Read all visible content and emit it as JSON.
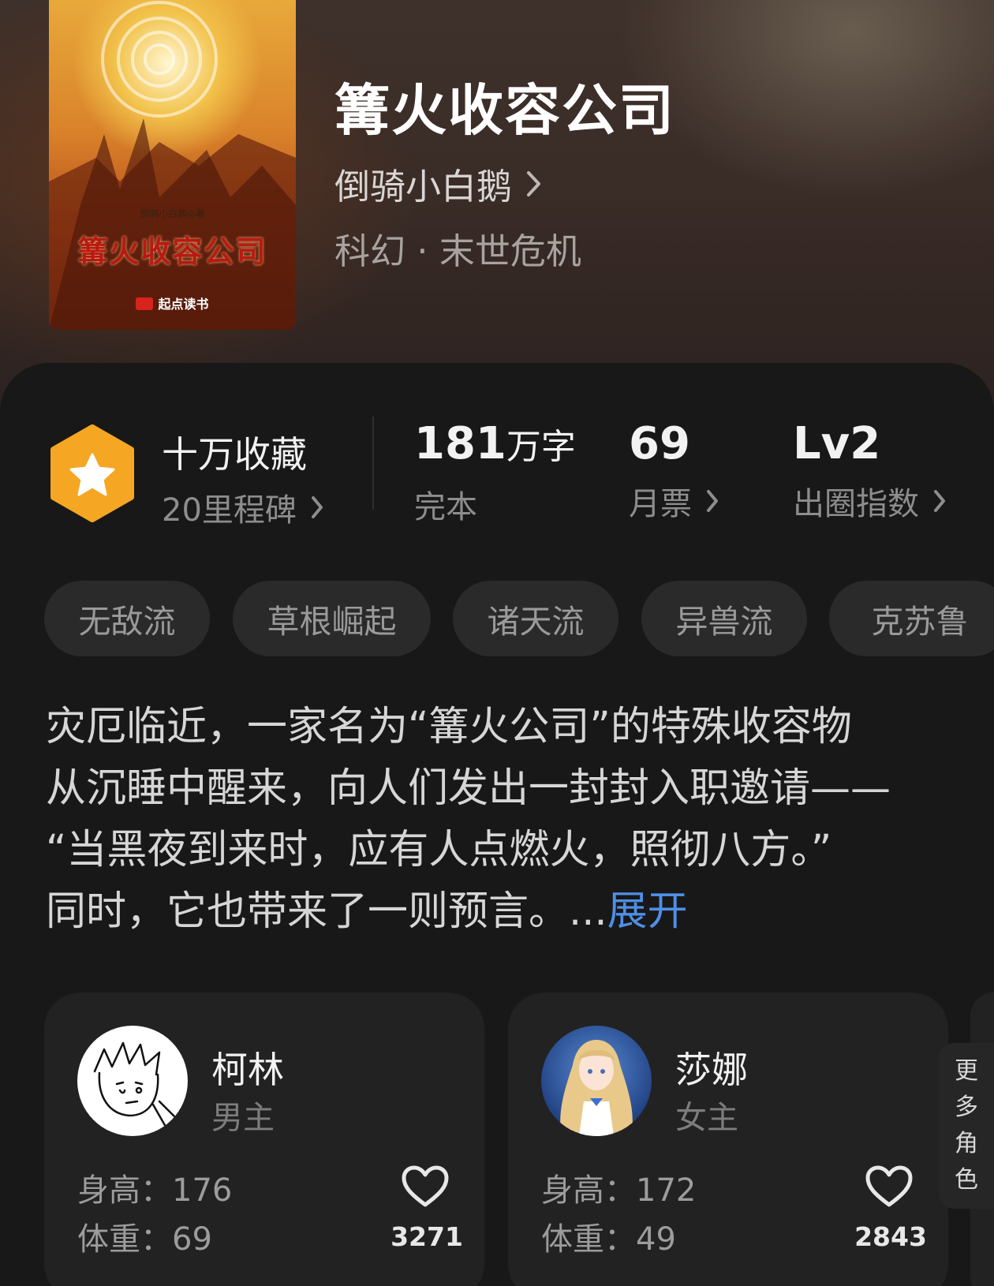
{
  "book": {
    "title": "篝火收容公司",
    "author": "倒骑小白鹅",
    "genre": "科幻 · 末世危机",
    "cover": {
      "author_line": "倒骑小白鹅◎著",
      "title": "篝火收容公司",
      "publisher": "起点读书"
    }
  },
  "stats": {
    "collection": {
      "title": "十万收藏",
      "sub": "20里程碑"
    },
    "words": {
      "number": "181",
      "unit": "万字",
      "sub": "完本"
    },
    "votes": {
      "number": "69",
      "sub": "月票"
    },
    "level": {
      "number": "Lv2",
      "sub": "出圈指数"
    }
  },
  "tags": [
    "无敌流",
    "草根崛起",
    "诸天流",
    "异兽流",
    "克苏鲁"
  ],
  "synopsis": {
    "lines": [
      "灾厄临近，一家名为“篝火公司”的特殊收容物",
      "从沉睡中醒来，向人们发出一封封入职邀请——",
      "“当黑夜到来时，应有人点燃火，照彻八方。”",
      "同时，它也带来了一则预言。..."
    ],
    "expand_label": "展开"
  },
  "characters": [
    {
      "name": "柯林",
      "role": "男主",
      "height": "身高：176",
      "weight": "体重：69",
      "likes": "3271"
    },
    {
      "name": "莎娜",
      "role": "女主",
      "height": "身高：172",
      "weight": "体重：49",
      "likes": "2843"
    }
  ],
  "more_roles": [
    "更",
    "多",
    "角",
    "色"
  ],
  "colors": {
    "background": "#151515",
    "card": "#222222",
    "badge": "#f5a623",
    "link": "#4f8fe6"
  },
  "icons": [
    "chevron-right-icon",
    "star-badge-icon",
    "heart-icon"
  ]
}
